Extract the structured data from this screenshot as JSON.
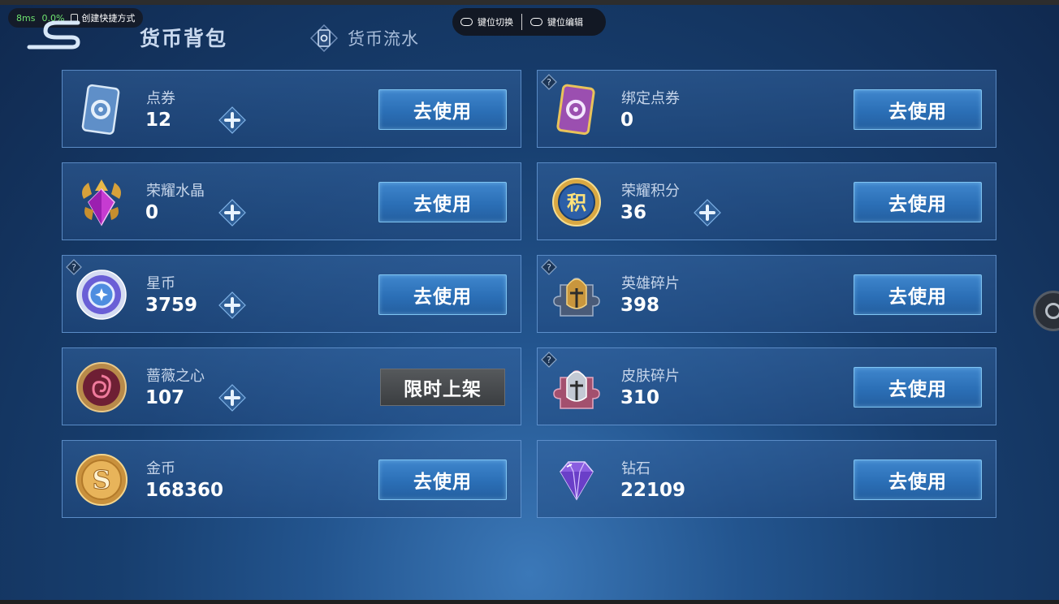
{
  "overlay": {
    "latency": "8ms",
    "cpu": "0.0%",
    "shortcut_label": "创建快捷方式",
    "key_switch": "键位切换",
    "key_edit": "键位编辑"
  },
  "header": {
    "title": "货币背包",
    "flow_tab": "货币流水"
  },
  "currencies": [
    {
      "name": "点券",
      "amount": "12",
      "button": "去使用",
      "icon": "ticket-icon"
    },
    {
      "name": "绑定点券",
      "amount": "0",
      "button": "去使用",
      "icon": "bound-ticket-icon"
    },
    {
      "name": "荣耀水晶",
      "amount": "0",
      "button": "去使用",
      "icon": "glory-crystal-icon"
    },
    {
      "name": "荣耀积分",
      "amount": "36",
      "button": "去使用",
      "icon": "glory-points-icon"
    },
    {
      "name": "星币",
      "amount": "3759",
      "button": "去使用",
      "icon": "star-coin-icon"
    },
    {
      "name": "英雄碎片",
      "amount": "398",
      "button": "去使用",
      "icon": "hero-fragment-icon"
    },
    {
      "name": "蔷薇之心",
      "amount": "107",
      "button": "限时上架",
      "icon": "rose-heart-icon"
    },
    {
      "name": "皮肤碎片",
      "amount": "310",
      "button": "去使用",
      "icon": "skin-fragment-icon"
    },
    {
      "name": "金币",
      "amount": "168360",
      "button": "去使用",
      "icon": "gold-coin-icon"
    },
    {
      "name": "钻石",
      "amount": "22109",
      "button": "去使用",
      "icon": "diamond-icon"
    }
  ],
  "colors": {
    "background": "#173e6e",
    "button": "#2b6fb6",
    "limited_button": "#4a4d50",
    "amount_text": "#ffffff"
  }
}
